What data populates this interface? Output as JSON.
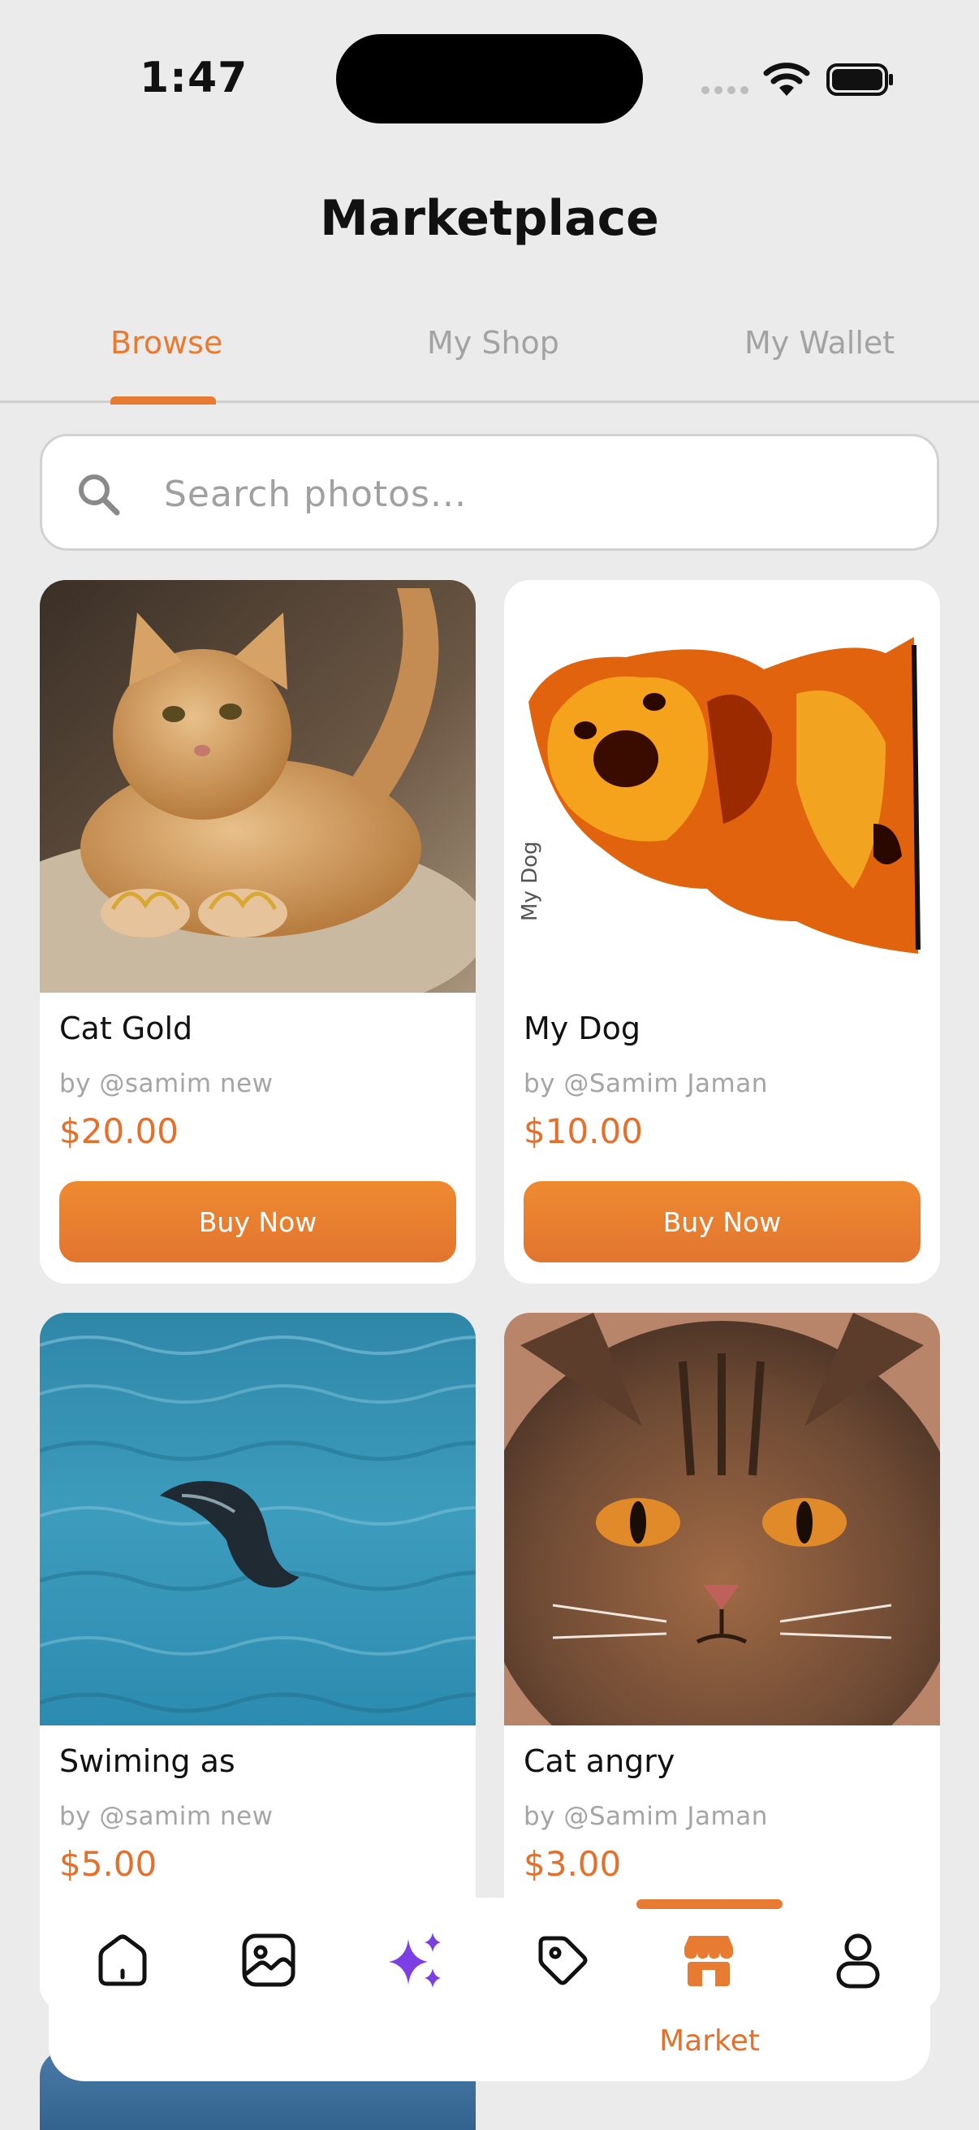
{
  "status": {
    "time": "1:47"
  },
  "header": {
    "title": "Marketplace"
  },
  "tabs": [
    {
      "label": "Browse",
      "active": true
    },
    {
      "label": "My Shop",
      "active": false
    },
    {
      "label": "My Wallet",
      "active": false
    }
  ],
  "search": {
    "placeholder": "Search photos...",
    "value": ""
  },
  "cards": [
    {
      "title": "Cat Gold",
      "author": "by @samim new",
      "price": "$20.00",
      "button": "Buy Now",
      "image_caption": ""
    },
    {
      "title": "My Dog",
      "author": "by @Samim Jaman",
      "price": "$10.00",
      "button": "Buy Now",
      "image_caption": "My Dog"
    },
    {
      "title": "Swiming as",
      "author": "by @samim new",
      "price": "$5.00"
    },
    {
      "title": "Cat angry",
      "author": "by @Samim Jaman",
      "price": "$3.00"
    }
  ],
  "bottom_nav": {
    "items": [
      {
        "icon": "home-icon"
      },
      {
        "icon": "gallery-icon"
      },
      {
        "icon": "sparkles-icon"
      },
      {
        "icon": "tag-icon"
      },
      {
        "icon": "store-icon",
        "active": true,
        "label": "Market"
      },
      {
        "icon": "profile-icon"
      }
    ]
  },
  "colors": {
    "accent": "#e87b32",
    "sparkle": "#7b3fe4",
    "background": "#ebebeb"
  }
}
